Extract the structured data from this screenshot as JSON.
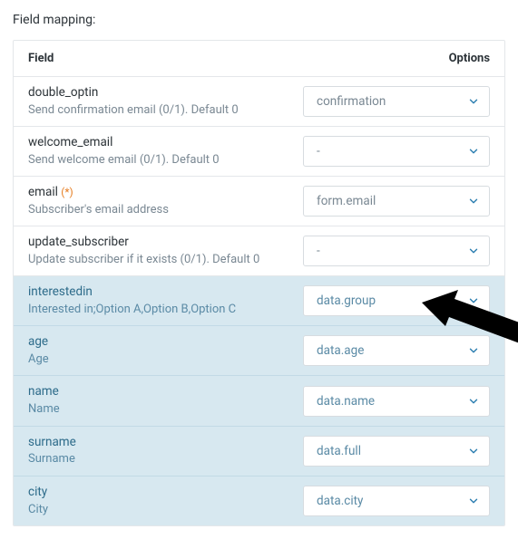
{
  "section_title": "Field mapping:",
  "headers": {
    "field": "Field",
    "options": "Options"
  },
  "required_marker": "(*)",
  "rows": [
    {
      "name": "double_optin",
      "desc": "Send confirmation email (0/1). Default 0",
      "value": "confirmation",
      "required": false,
      "highlight": false
    },
    {
      "name": "welcome_email",
      "desc": "Send welcome email (0/1). Default 0",
      "value": "-",
      "required": false,
      "highlight": false
    },
    {
      "name": "email",
      "desc": "Subscriber's email address",
      "value": "form.email",
      "required": true,
      "highlight": false
    },
    {
      "name": "update_subscriber",
      "desc": "Update subscriber if it exists (0/1). Default 0",
      "value": "-",
      "required": false,
      "highlight": false
    },
    {
      "name": "interestedin",
      "desc": "Interested in;Option A,Option B,Option C",
      "value": "data.group",
      "required": false,
      "highlight": true
    },
    {
      "name": "age",
      "desc": "Age",
      "value": "data.age",
      "required": false,
      "highlight": true
    },
    {
      "name": "name",
      "desc": "Name",
      "value": "data.name",
      "required": false,
      "highlight": true
    },
    {
      "name": "surname",
      "desc": "Surname",
      "value": "data.full",
      "required": false,
      "highlight": true
    },
    {
      "name": "city",
      "desc": "City",
      "value": "data.city",
      "required": false,
      "highlight": true
    }
  ]
}
